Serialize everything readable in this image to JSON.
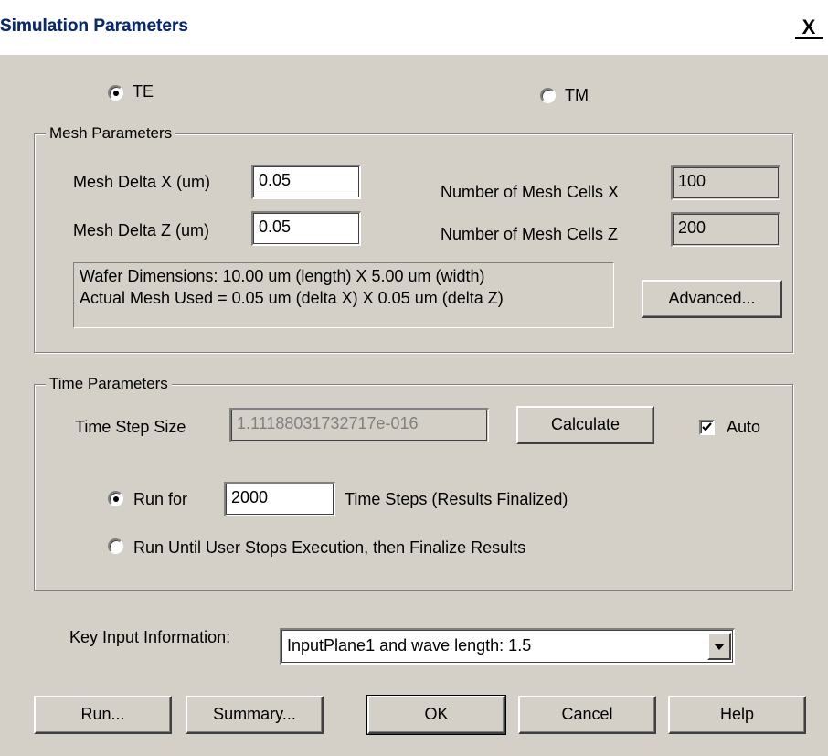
{
  "window": {
    "title": "Simulation Parameters",
    "close_glyph": "X"
  },
  "polarization": {
    "te_label": "TE",
    "tm_label": "TM",
    "selected": "TE"
  },
  "mesh": {
    "group_label": "Mesh Parameters",
    "delta_x_label": "Mesh Delta X (um)",
    "delta_x_value": "0.05",
    "delta_z_label": "Mesh Delta Z (um)",
    "delta_z_value": "0.05",
    "cells_x_label": "Number of Mesh Cells X",
    "cells_x_value": "100",
    "cells_z_label": "Number of Mesh Cells Z",
    "cells_z_value": "200",
    "info_line1": "Wafer Dimensions: 10.00 um (length) X 5.00 um (width)",
    "info_line2": "Actual Mesh Used = 0.05 um (delta X) X 0.05 um (delta Z)",
    "advanced_label": "Advanced..."
  },
  "time": {
    "group_label": "Time Parameters",
    "step_size_label": "Time Step Size",
    "step_size_value": "1.11188031732717e-016",
    "calculate_label": "Calculate",
    "auto_label": "Auto",
    "auto_checked": true,
    "run_for_label": "Run for",
    "run_for_value": "2000",
    "time_steps_label": "Time Steps (Results Finalized)",
    "run_until_label": "Run Until User Stops Execution, then Finalize Results",
    "selected": "run_for"
  },
  "key_input": {
    "label": "Key Input Information:",
    "selected_value": "InputPlane1 and wave length: 1.5"
  },
  "buttons": {
    "run": "Run...",
    "summary": "Summary...",
    "ok": "OK",
    "cancel": "Cancel",
    "help": "Help"
  }
}
